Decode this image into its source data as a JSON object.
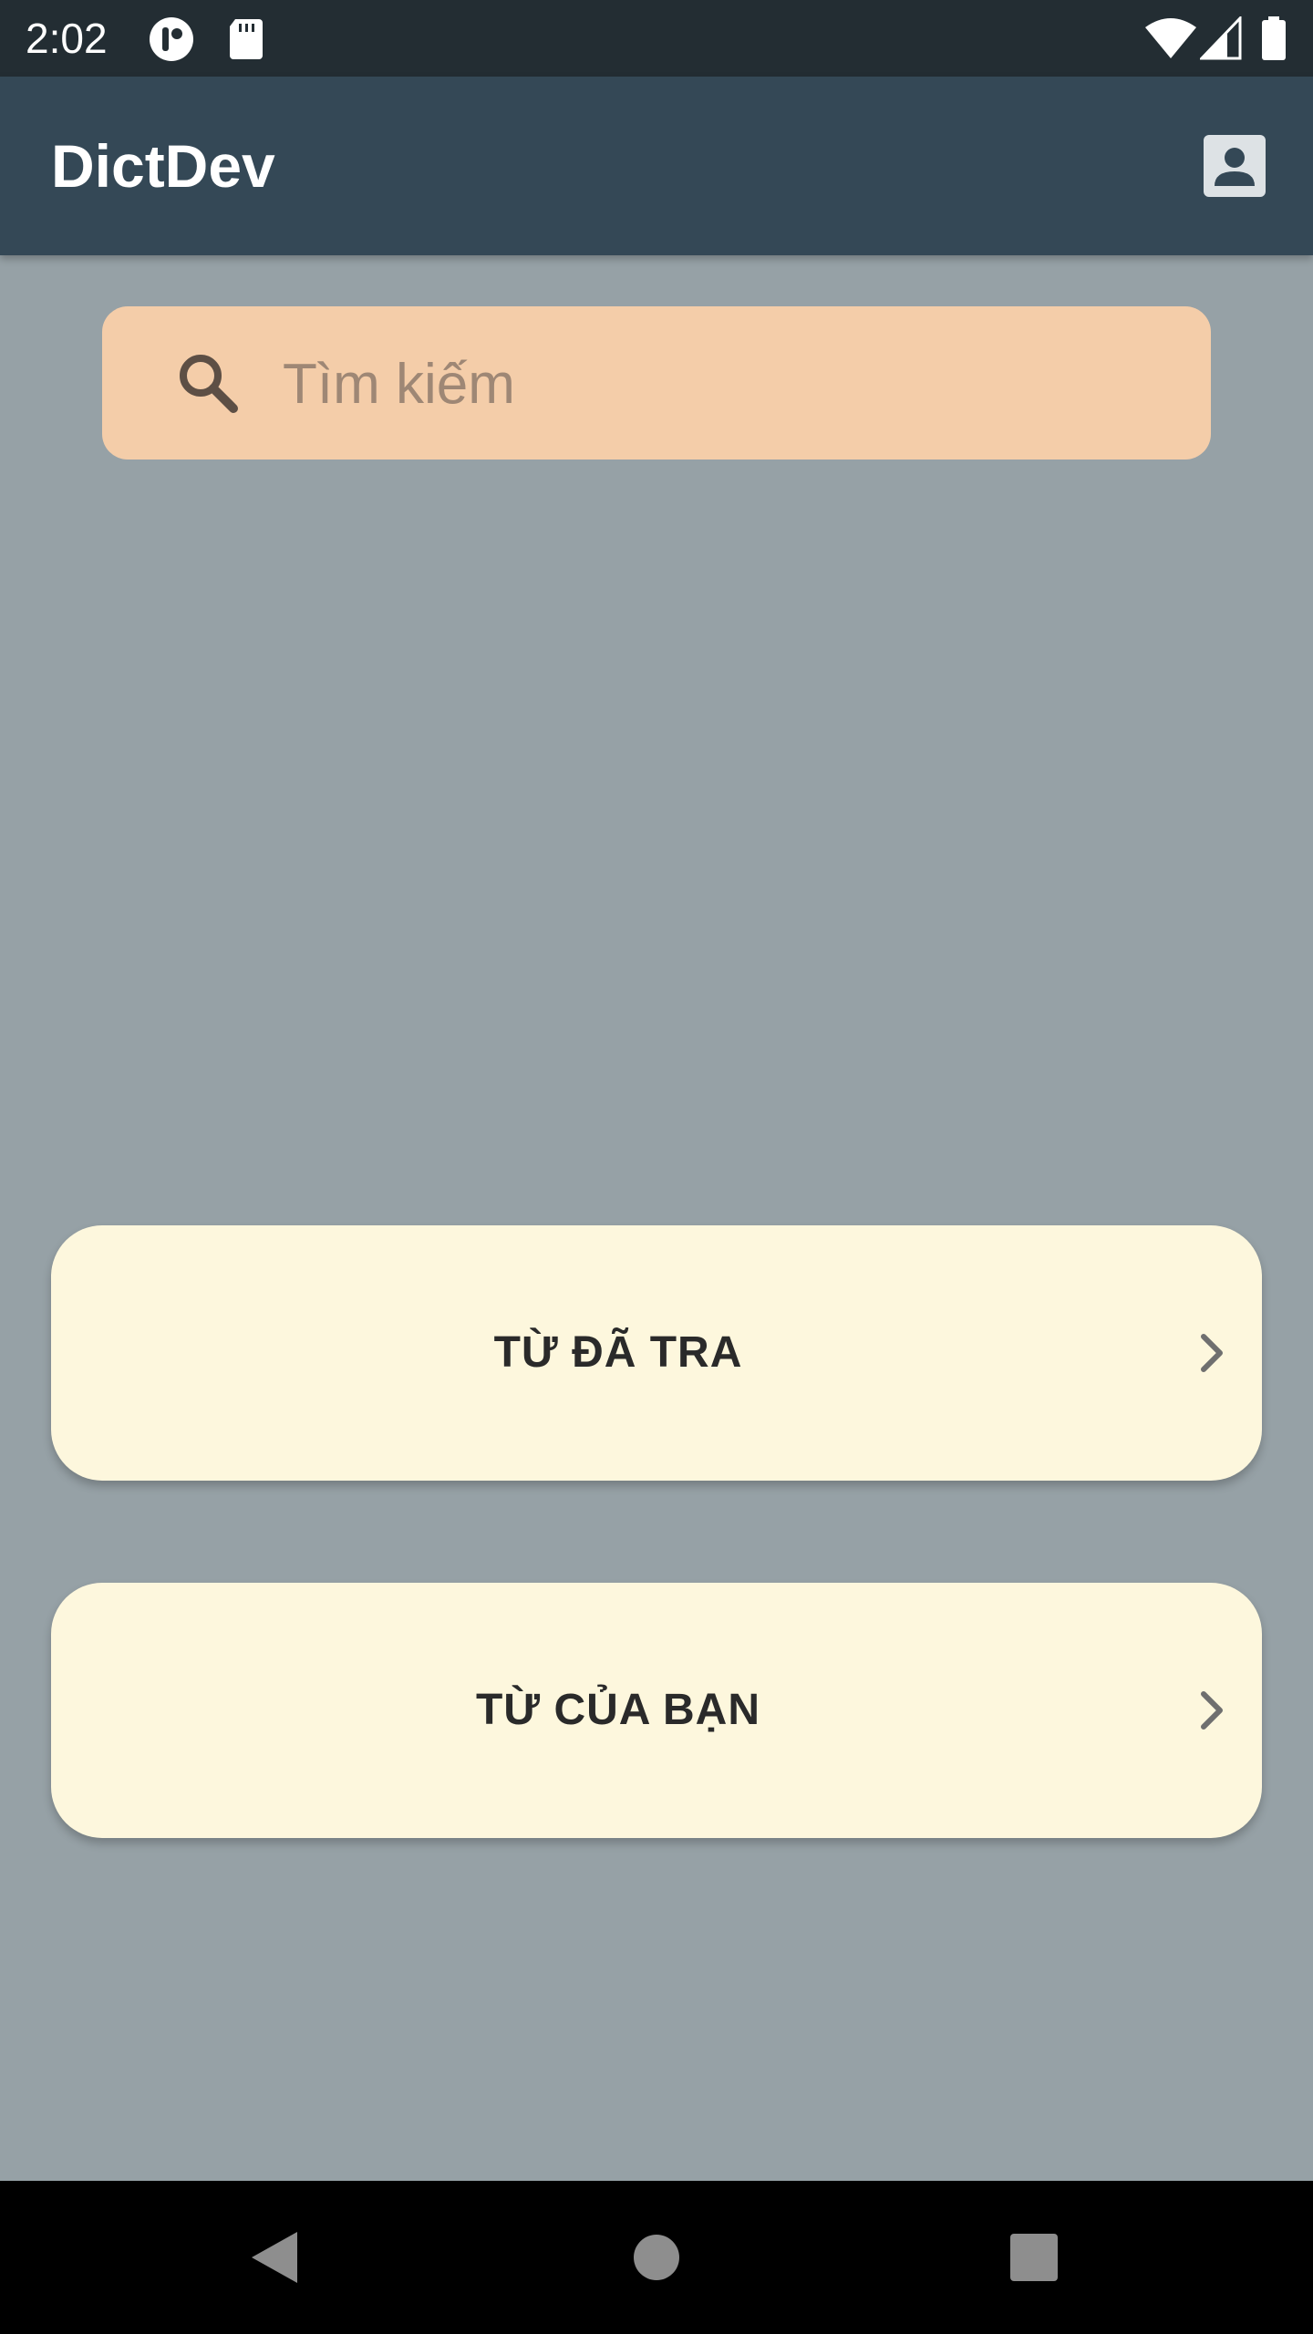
{
  "status_bar": {
    "time": "2:02",
    "left_icons": [
      "app-notification-icon",
      "sd-card-icon"
    ],
    "right_icons": [
      "wifi-icon",
      "cellular-signal-icon",
      "battery-icon"
    ]
  },
  "app_bar": {
    "title": "DictDev",
    "account_icon": "account-box-icon"
  },
  "search": {
    "placeholder": "Tìm kiếm",
    "value": "",
    "icon": "search-icon"
  },
  "menu": {
    "items": [
      {
        "label": "TỪ ĐÃ TRA",
        "icon": "chevron-right-icon"
      },
      {
        "label": "TỪ CỦA BẠN",
        "icon": "chevron-right-icon"
      }
    ]
  },
  "nav_bar": {
    "buttons": [
      "back-icon",
      "home-icon",
      "recents-icon"
    ]
  },
  "colors": {
    "background": "#96a1a6",
    "status_bar": "#232d33",
    "app_bar": "#344856",
    "search_fill": "#f4cda9",
    "card_fill": "#fdf7dd",
    "nav_bar": "#000000"
  }
}
